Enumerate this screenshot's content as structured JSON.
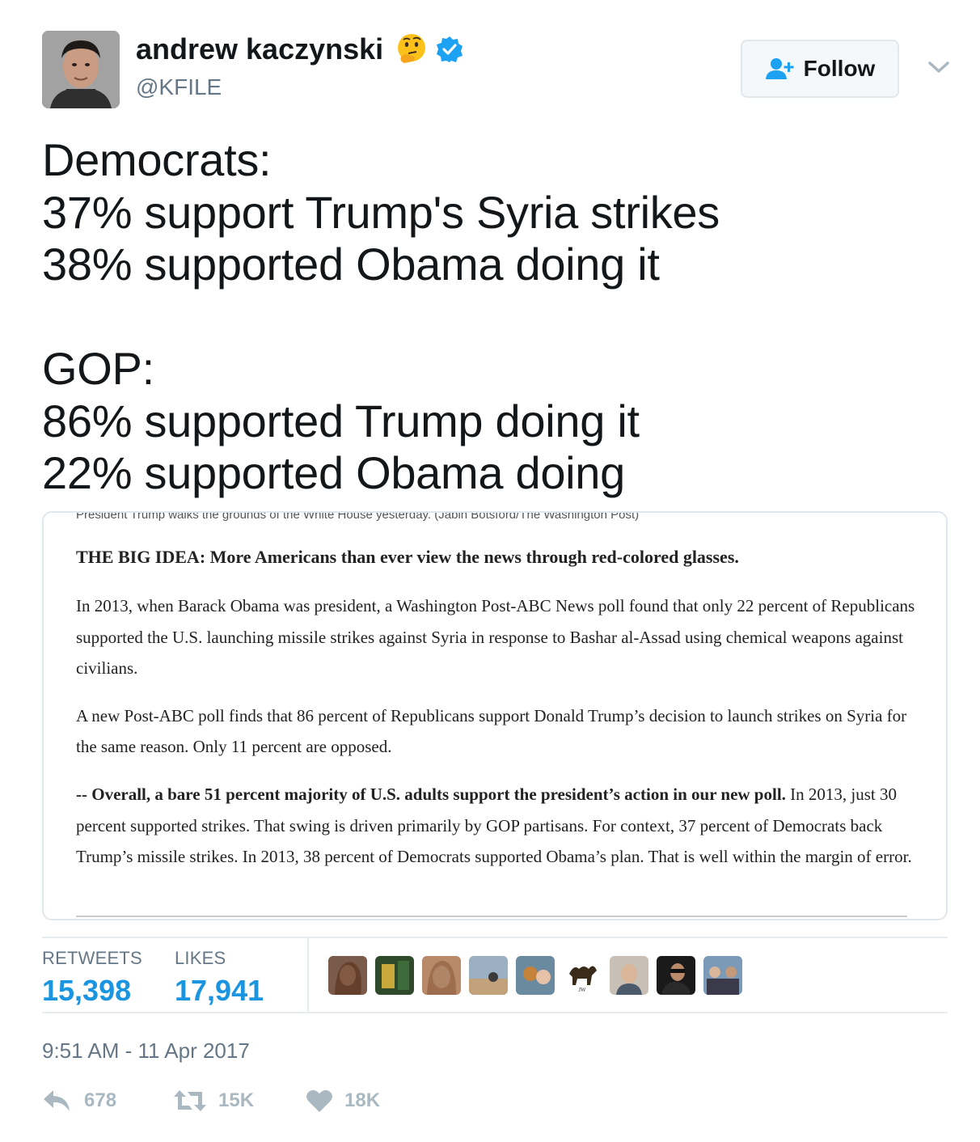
{
  "user": {
    "name": "andrew kaczynski",
    "handle": "@KFILE",
    "verified": true,
    "emoji": "thinking-face"
  },
  "follow": {
    "label": "Follow"
  },
  "tweet": {
    "lines": [
      "Democrats:",
      "37% support Trump's Syria strikes",
      "38% supported Obama doing it",
      "",
      "GOP:",
      "86% supported Trump doing it",
      "22% supported Obama doing"
    ]
  },
  "media": {
    "caption": "President Trump walks the grounds of the White House yesterday. (Jabin Botsford/The Washington Post)",
    "headline": "THE BIG IDEA: More Americans than ever view the news through red-colored glasses.",
    "p1": "In 2013, when Barack Obama was president, a Washington Post-ABC News poll found that only 22 percent of Republicans supported the U.S. launching missile strikes against Syria in response to Bashar al-Assad using chemical weapons against civilians.",
    "p2": "A new Post-ABC poll finds that 86 percent of Republicans support Donald Trump’s decision to launch strikes on Syria for the same reason. Only 11 percent are opposed.",
    "p3_bold": "-- Overall, a bare 51 percent majority of U.S. adults support the president’s action in our new poll.",
    "p3_rest": " In 2013, just 30 percent supported strikes. That swing is driven primarily by GOP partisans. For context, 37 percent of Democrats back Trump’s missile strikes. In 2013, 38 percent of Democrats supported Obama’s plan. That is well within the margin of error."
  },
  "stats": {
    "retweets_label": "RETWEETS",
    "retweets_value": "15,398",
    "likes_label": "LIKES",
    "likes_value": "17,941"
  },
  "timestamp": "9:51 AM - 11 Apr 2017",
  "actions": {
    "reply_count": "678",
    "retweet_count": "15K",
    "like_count": "18K"
  },
  "colors": {
    "accent": "#1b95e0",
    "muted": "#657786",
    "action_gray": "#aab8c2",
    "border": "#e1e8ed"
  }
}
